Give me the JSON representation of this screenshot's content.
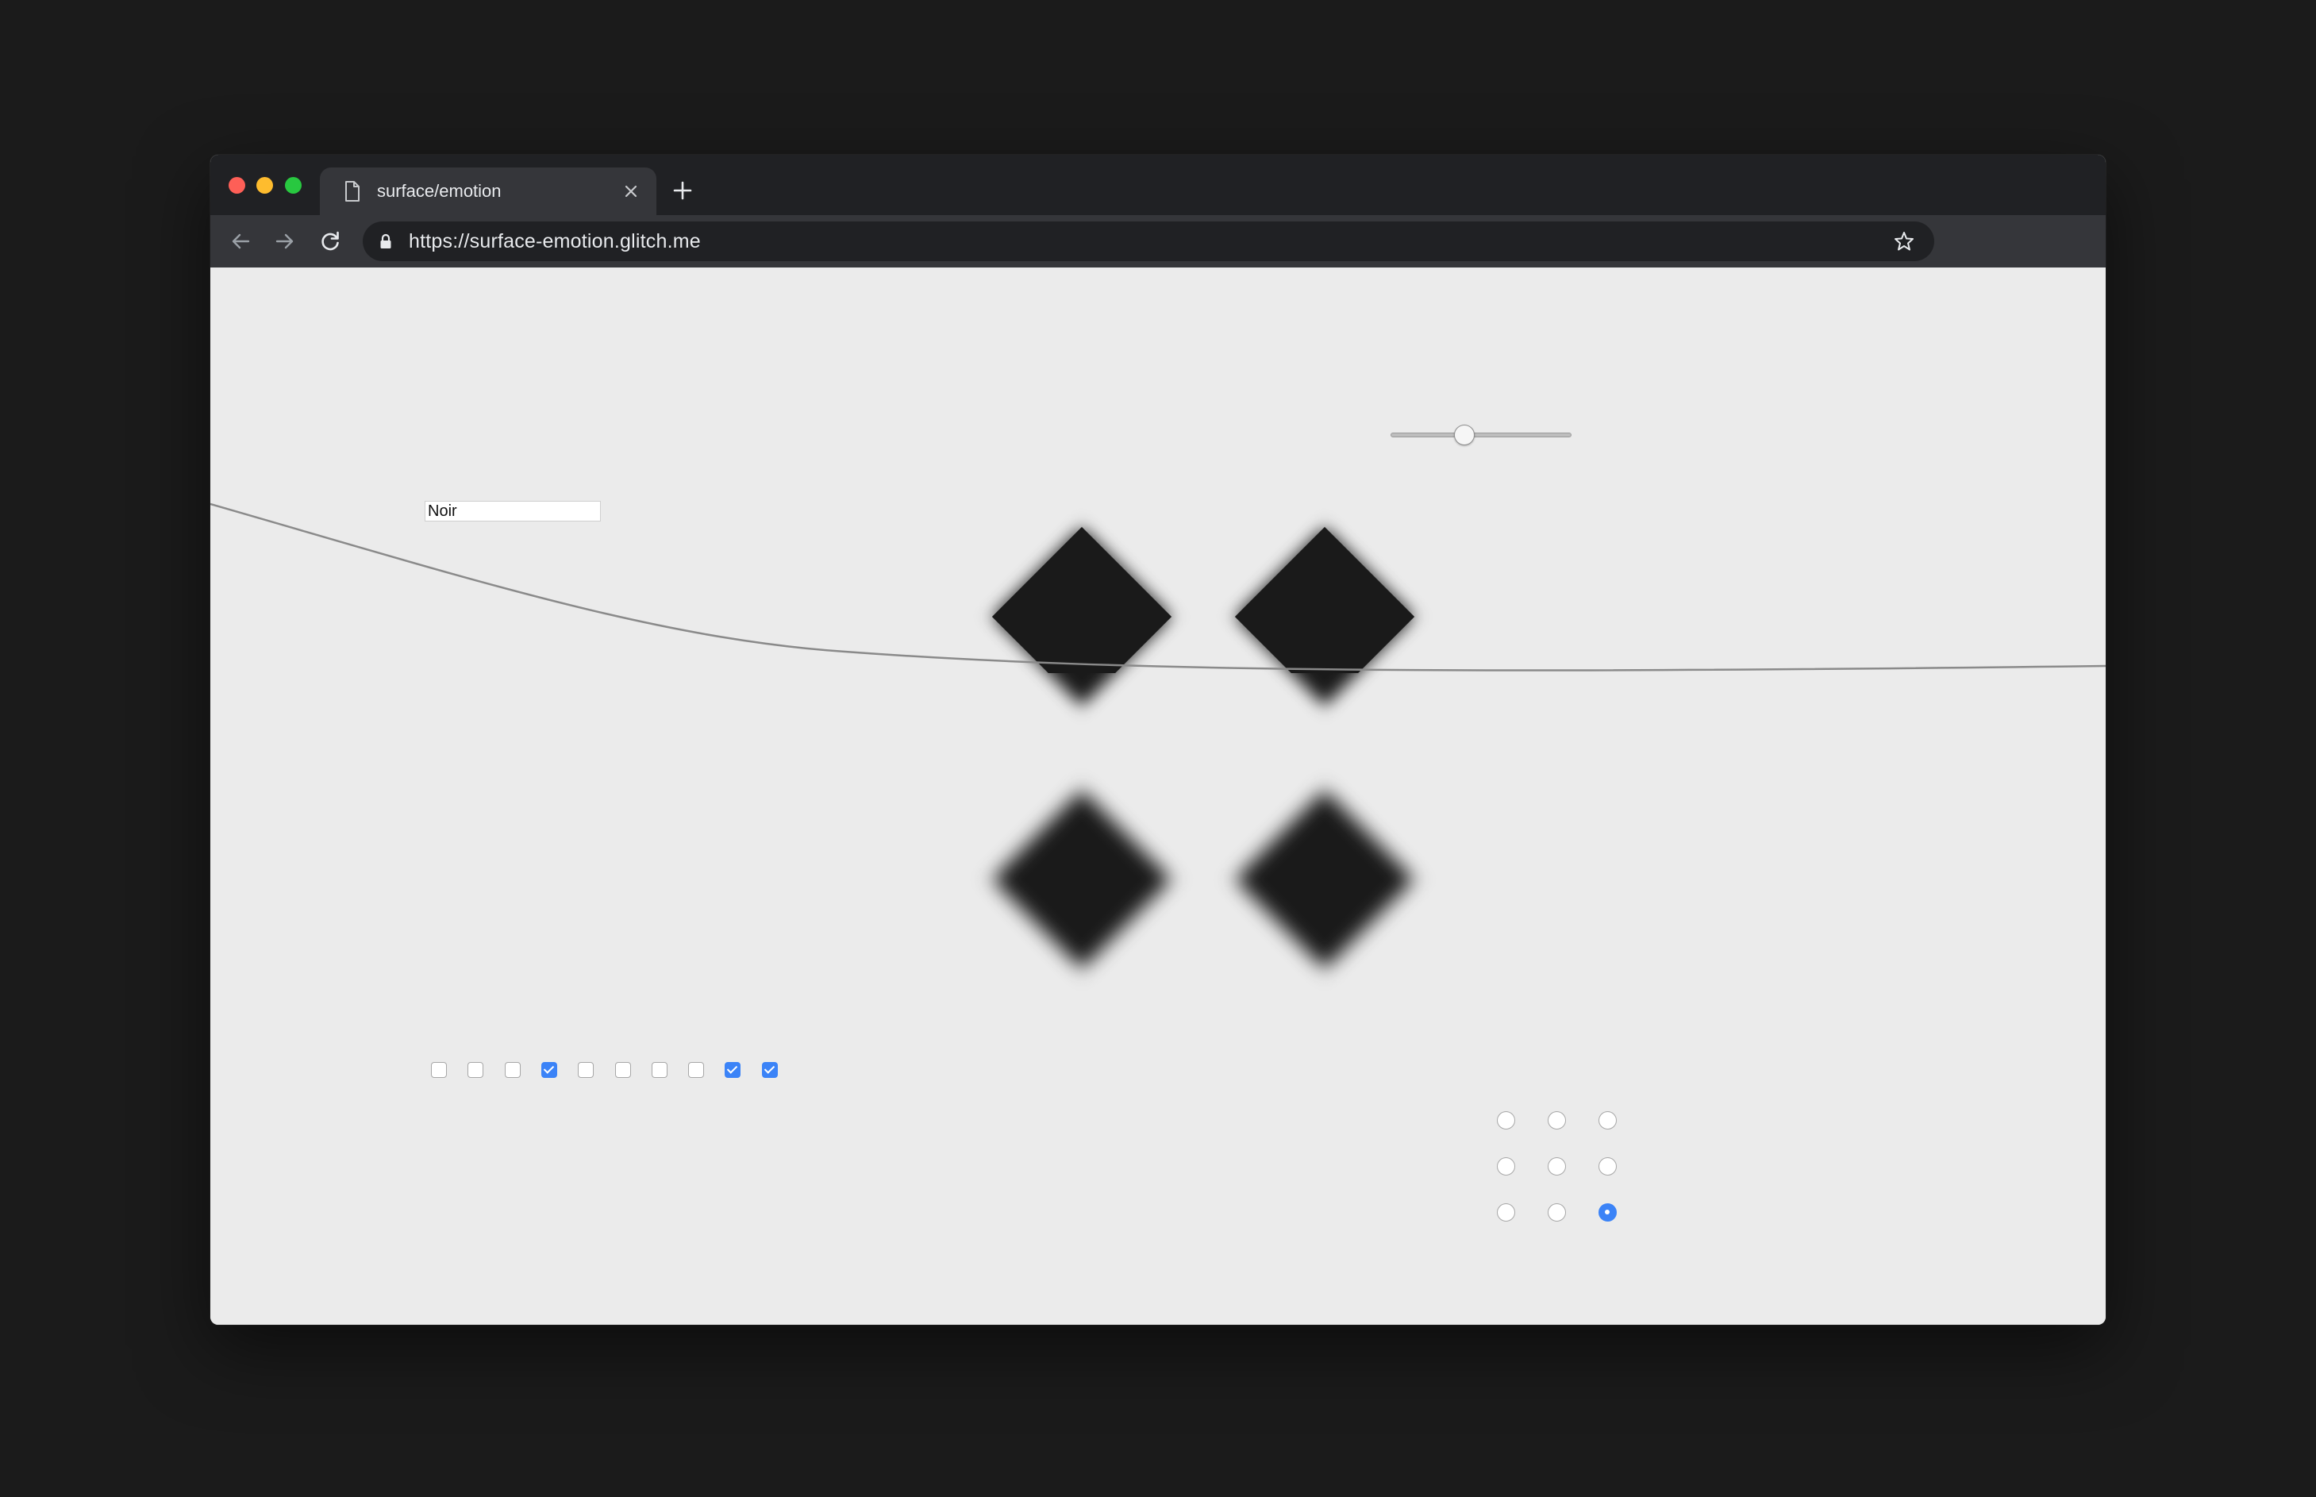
{
  "browser": {
    "tab": {
      "title": "surface/emotion",
      "icon": "document-icon",
      "close_icon": "close-icon"
    },
    "new_tab_icon": "plus-icon",
    "nav": {
      "back_icon": "arrow-left-icon",
      "forward_icon": "arrow-right-icon",
      "reload_icon": "reload-icon"
    },
    "address_bar": {
      "url": "https://surface-emotion.glitch.me",
      "lock_icon": "lock-icon",
      "bookmark_icon": "star-icon"
    },
    "traffic_lights": {
      "close_color": "#fe5f57",
      "minimize_color": "#febc2e",
      "maximize_color": "#28c840"
    }
  },
  "page": {
    "background_color": "#ebebeb",
    "text_field": {
      "value": "Noir"
    },
    "slider": {
      "value_fraction": 0.41
    },
    "checkboxes": [
      false,
      false,
      false,
      true,
      false,
      false,
      false,
      false,
      true,
      true
    ],
    "radio_grid": {
      "rows": 3,
      "cols": 3,
      "selected_index": 8
    },
    "accent_color": "#3b83f7",
    "shape_color": "#1a1a1a"
  }
}
